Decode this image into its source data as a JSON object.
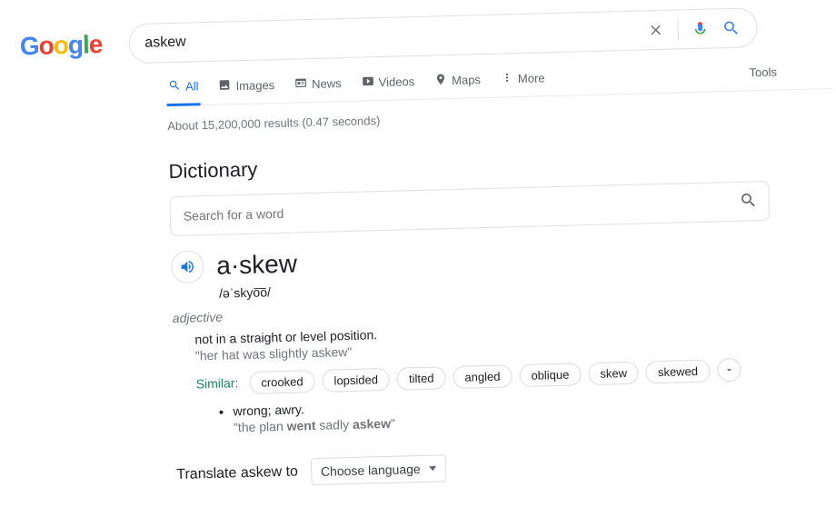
{
  "logo_letters": [
    "G",
    "o",
    "o",
    "g",
    "l",
    "e"
  ],
  "search": {
    "value": "askew"
  },
  "tabs": [
    {
      "label": "All",
      "icon": "search",
      "active": true
    },
    {
      "label": "Images",
      "icon": "image"
    },
    {
      "label": "News",
      "icon": "news"
    },
    {
      "label": "Videos",
      "icon": "video"
    },
    {
      "label": "Maps",
      "icon": "pin"
    },
    {
      "label": "More",
      "icon": "more"
    }
  ],
  "tools_label": "Tools",
  "stats": "About 15,200,000 results (0.47 seconds)",
  "dict": {
    "heading": "Dictionary",
    "search_placeholder": "Search for a word",
    "word": "a·skew",
    "pronunciation": "/əˈskyo͞o/",
    "part_of_speech": "adjective",
    "definition": "not in a straight or level position.",
    "example": "\"her hat was slightly askew\"",
    "similar_label": "Similar:",
    "similar": [
      "crooked",
      "lopsided",
      "tilted",
      "angled",
      "oblique",
      "skew",
      "skewed"
    ],
    "sub_definition": "wrong; awry.",
    "sub_example_pre": "\"the plan ",
    "sub_example_bold": "went",
    "sub_example_mid": " sadly ",
    "sub_example_bold2": "askew",
    "sub_example_post": "\""
  },
  "translate": {
    "label": "Translate askew to",
    "select": "Choose language"
  }
}
